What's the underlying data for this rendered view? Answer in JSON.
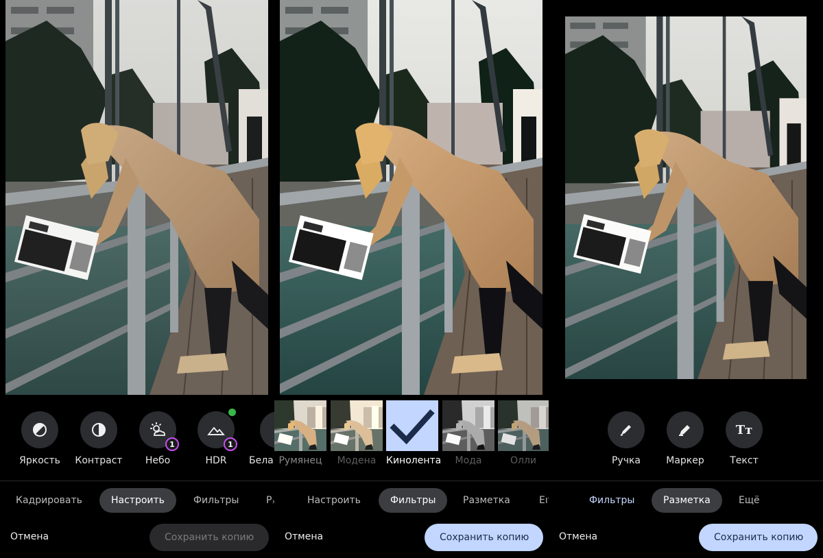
{
  "panel1": {
    "tools": [
      {
        "label": "Яркость",
        "icon": "brightness-icon"
      },
      {
        "label": "Контраст",
        "icon": "contrast-icon"
      },
      {
        "label": "Небо",
        "icon": "sky-icon",
        "badge": "1"
      },
      {
        "label": "HDR",
        "icon": "hdr-icon",
        "badge": "1"
      },
      {
        "label": "Бела",
        "icon": "white-balance-icon"
      }
    ],
    "tabs": [
      "Кадрировать",
      "Настроить",
      "Фильтры",
      "Рₓ"
    ],
    "active_tab": "Настроить",
    "cancel": "Отмена",
    "save": "Сохранить копию"
  },
  "panel2": {
    "filters": [
      {
        "label": "Румянец"
      },
      {
        "label": "Модена"
      },
      {
        "label": "Кинолента",
        "selected": true
      },
      {
        "label": "Мода"
      },
      {
        "label": "Олли"
      }
    ],
    "tabs": [
      "Настроить",
      "Фильтры",
      "Разметка",
      "Еıть"
    ],
    "active_tab": "Фильтры",
    "cancel": "Отмена",
    "save": "Сохранить копию"
  },
  "panel3": {
    "tools": [
      {
        "label": "Ручка",
        "icon": "pen-icon"
      },
      {
        "label": "Маркер",
        "icon": "marker-icon"
      },
      {
        "label": "Текст",
        "icon": "text-icon",
        "glyph": "Tт"
      }
    ],
    "tabs": [
      "Фильтры",
      "Разметка",
      "Ещё"
    ],
    "active_tab": "Разметка",
    "cancel": "Отмена",
    "save": "Сохранить копию"
  },
  "colors": {
    "accent": "#c2d6ff",
    "active_tab_bg": "#3c3d40",
    "tool_circle": "#2b2d31",
    "badge_ring": "#c84ef0",
    "green_dot": "#38b74a"
  }
}
